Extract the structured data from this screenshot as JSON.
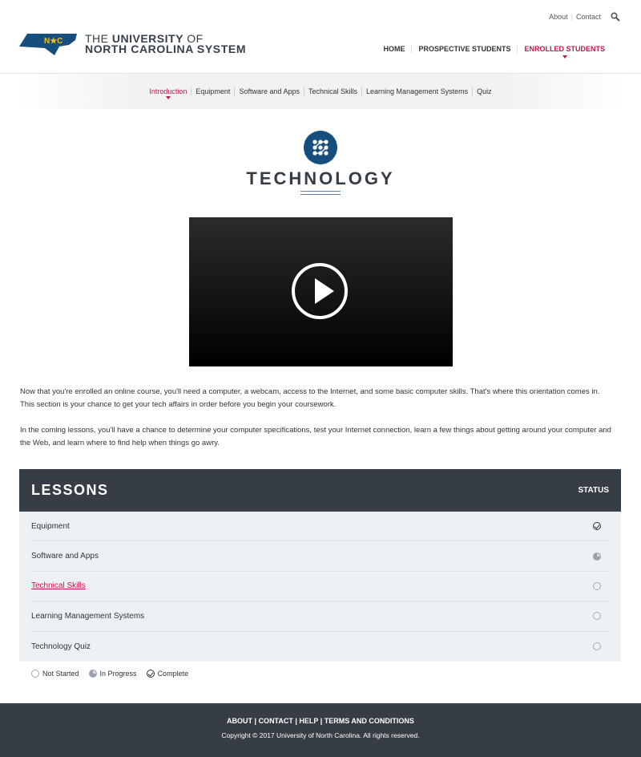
{
  "utility": {
    "about": "About",
    "contact": "Contact",
    "search_icon": "search-icon"
  },
  "logo": {
    "state_text": "N★C",
    "line1_a": "THE ",
    "line1_b": "UNIVERSITY",
    "line1_c": " OF",
    "line2": "NORTH CAROLINA SYSTEM"
  },
  "nav": [
    {
      "label": "HOME"
    },
    {
      "label": "PROSPECTIVE STUDENTS"
    },
    {
      "label": "ENROLLED STUDENTS",
      "active": true
    }
  ],
  "subnav": [
    {
      "label": "Introduction",
      "active": true
    },
    {
      "label": "Equipment"
    },
    {
      "label": "Software and Apps"
    },
    {
      "label": "Technical Skills"
    },
    {
      "label": "Learning Management Systems"
    },
    {
      "label": "Quiz"
    }
  ],
  "page": {
    "title": "TECHNOLOGY",
    "icon": "circuit-icon"
  },
  "video": {
    "icon": "play-icon"
  },
  "intro": [
    "Now that you're enrolled an online course, you'll need a computer, a webcam, access to the Internet, and some basic computer skills. That's where this orientation comes in. This section is your chance to get your tech affairs in order before you begin your coursework.",
    "In the coming lessons, you'll have a chance to determine your computer specifications, test your Internet connection, learn a few things about getting around your computer and the Web, and learn where to find help when things go awry."
  ],
  "lessons": {
    "heading": "LESSONS",
    "status_label": "STATUS",
    "items": [
      {
        "title": "Equipment",
        "status": "complete"
      },
      {
        "title": "Software and Apps",
        "status": "in-progress"
      },
      {
        "title": "Technical Skills",
        "status": "not-started",
        "link": true
      },
      {
        "title": "Learning Management Systems",
        "status": "not-started"
      },
      {
        "title": "Technology Quiz",
        "status": "not-started"
      }
    ]
  },
  "legend": {
    "not_started": "Not Started",
    "in_progress": "In Progress",
    "complete": "Complete"
  },
  "footer": {
    "links": "ABOUT | CONTACT | HELP  | TERMS AND CONDITIONS",
    "copyright": "Copyright © 2017 University of North Carolina. All rights reserved."
  },
  "colors": {
    "accent": "#c4154a",
    "brand_blue": "#164e7e",
    "dark": "#363d44"
  }
}
